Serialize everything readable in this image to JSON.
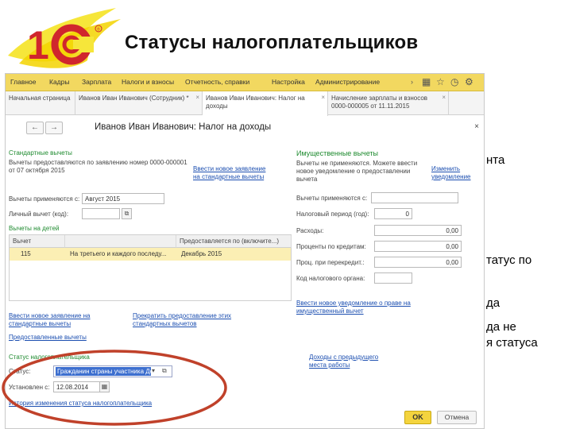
{
  "slide": {
    "title": "Статусы налогоплательщиков",
    "logo_text": "1С",
    "background_fragments": [
      "нта",
      "татус по",
      "да",
      "да не",
      "я статуса"
    ]
  },
  "app": {
    "menu": [
      "Главное",
      "Кадры",
      "Зарплата",
      "Налоги и взносы",
      "Отчетность, справки",
      "Настройка",
      "Администрирование"
    ],
    "toolbar_icons": [
      "grid-icon",
      "star-icon",
      "history-icon",
      "settings-icon"
    ],
    "tabs": [
      {
        "label": "Начальная страница"
      },
      {
        "label": "Иванов Иван Иванович (Сотрудник) *"
      },
      {
        "label": "Иванов Иван Иванович: Налог на доходы"
      },
      {
        "label": "Начисление зарплаты и взносов 0000-000005 от 11.11.2015"
      }
    ],
    "form": {
      "back_icon": "←",
      "forward_icon": "→",
      "title": "Иванов Иван Иванович: Налог на доходы",
      "close_icon": "×",
      "standard": {
        "header": "Стандартные вычеты",
        "info": "Вычеты предоставляются по заявлению номер 0000-000001 от 07 октября 2015",
        "enter_link": "Ввести новое заявление на стандартные вычеты",
        "start_label": "Вычеты применяются с:",
        "start_value": "Август 2015",
        "personal_label": "Личный вычет (код):",
        "personal_value": "",
        "children_header": "Вычеты на детей",
        "table_headers": [
          "Вычет",
          "",
          "Предоставляется по (включите...)"
        ],
        "table_rows": [
          {
            "code": "115",
            "desc": "На третьего и каждого последу...",
            "until": "Декабрь 2015"
          }
        ],
        "enter_statement_link": "Ввести новое заявление на стандартные вычеты",
        "stop_link": "Прекратить предоставление этих стандартных вычетов",
        "prev_employer": "Предоставленные вычеты"
      },
      "property": {
        "header": "Имущественные вычеты",
        "info": "Вычеты не применяются. Можете ввести новое уведомление о предоставлении вычета",
        "change_link": "Изменить уведомление",
        "start_label": "Вычеты применяются с:",
        "start_value": "",
        "period_label": "Налоговый период (год):",
        "period_value": "0",
        "expenses_label": "Расходы:",
        "expenses_value": "0,00",
        "credits_label": "Проценты по кредитам:",
        "credits_value": "0,00",
        "refinance_label": "Проц. при перекредит.:",
        "refinance_value": "0,00",
        "tax_code_label": "Код налогового органа:",
        "tax_code_value": "",
        "enter_notice_link": "Ввести новое уведомление о праве на имущественный вычет",
        "prev_income_link": "Доходы с предыдущего места работы"
      },
      "status": {
        "header": "Статус налогоплательщика",
        "status_label": "Статус:",
        "status_value": "Гражданин страны участника Дог",
        "set_label": "Установлен с:",
        "set_value": "12.08.2014",
        "history_link": "История изменения статуса налогоплательщика"
      },
      "ok_label": "OK",
      "cancel_label": "Отмена"
    }
  },
  "colors": {
    "menubar": "#f2d860",
    "highlight": "#c0412a",
    "link": "#1b4eb0",
    "section": "#1d8a2e"
  }
}
